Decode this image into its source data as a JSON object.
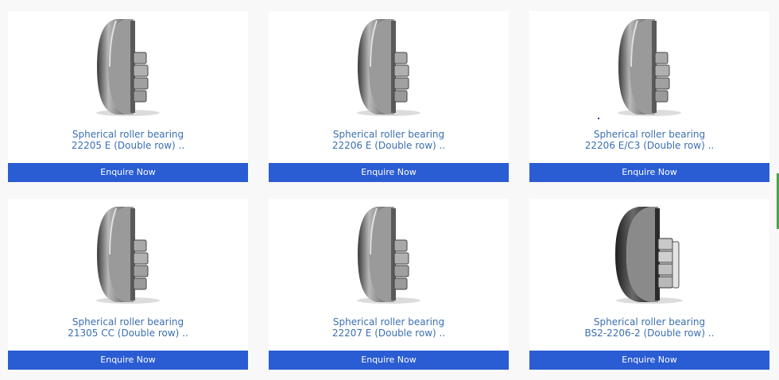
{
  "products": [
    {
      "line1": "Spherical roller bearing",
      "line2": "22205 E (Double row) ..",
      "button": "Enquire Now",
      "image": "bearing-split-icon"
    },
    {
      "line1": "Spherical roller bearing",
      "line2": "22206 E (Double row) ..",
      "button": "Enquire Now",
      "image": "bearing-split-icon"
    },
    {
      "line1": "Spherical roller bearing",
      "line2": "22206 E/C3 (Double row) ..",
      "button": "Enquire Now",
      "image": "bearing-split-icon"
    },
    {
      "line1": "Spherical roller bearing",
      "line2": "21305 CC (Double row) ..",
      "button": "Enquire Now",
      "image": "bearing-split-icon"
    },
    {
      "line1": "Spherical roller bearing",
      "line2": "22207 E (Double row) ..",
      "button": "Enquire Now",
      "image": "bearing-split-icon"
    },
    {
      "line1": "Spherical roller bearing",
      "line2": "BS2-2206-2 (Double row) ..",
      "button": "Enquire Now",
      "image": "sealed-bearing-icon"
    }
  ],
  "colors": {
    "button_bg": "#2a5cd3",
    "title_text": "#3b6fb0",
    "page_bg": "#f8f8f8"
  }
}
